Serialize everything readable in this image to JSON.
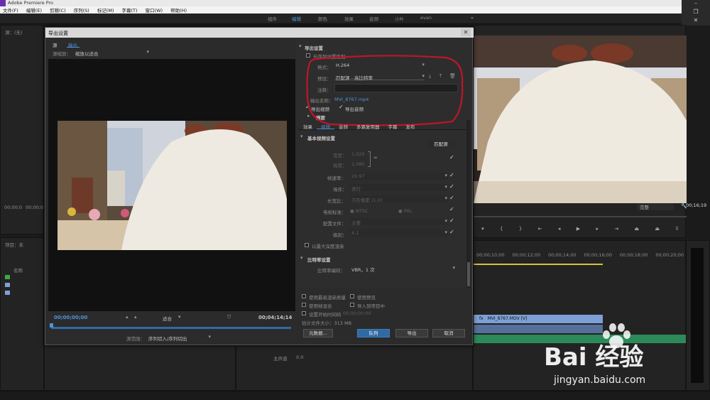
{
  "app": {
    "title": "Adobe Premiere Pro",
    "menu": [
      "文件(F)",
      "编辑(E)",
      "剪辑(C)",
      "序列(S)",
      "标记(M)",
      "字幕(T)",
      "窗口(W)",
      "帮助(H)"
    ],
    "workspaces": [
      "组件",
      "编辑",
      "颜色",
      "效果",
      "音频",
      "小叶",
      "evan"
    ],
    "active_workspace": "编辑"
  },
  "left_panel": {
    "source_label": "源：(无)",
    "timecode_left": "00;00;0",
    "timecode_mid": "00;00;0",
    "project_label": "项目：未",
    "media_label": "名称",
    "media_label2": "序列名"
  },
  "program_monitor": {
    "timecode": "00;16;19",
    "zoom": "完整"
  },
  "timeline": {
    "ruler": [
      "00;00;10;00",
      "00;00;12;00",
      "00;00;14;00",
      "00;00;16;00",
      "00;00;18;00",
      "00;00;20;00"
    ],
    "clip_video": "MVI_8767.MOV [V]",
    "clip_fx": "fx",
    "track_master": "主声道",
    "master_value": "0.0"
  },
  "dialog": {
    "title": "导出设置",
    "tabs": [
      "源",
      "输出"
    ],
    "active_tab": "输出",
    "source_scaling_label": "源缩放：",
    "source_scaling_value": "缩放以适合",
    "timecode_in": "00;00;00;00",
    "timecode_out": "00;04;14;14",
    "fit_label": "适合",
    "source_range_label": "源范围：",
    "source_range_value": "序列切入/序列切出",
    "export_settings": {
      "section": "导出设置",
      "match_sequence": "与序列设置匹配",
      "format_label": "格式：",
      "format_value": "H.264",
      "preset_label": "预设：",
      "preset_value": "匹配源 - 高比特率",
      "comments_label": "注释：",
      "output_name_label": "输出名称：",
      "output_name_value": "MVI_8767.mp4",
      "export_video": "导出视频",
      "export_audio": "导出音频",
      "summary": "摘要"
    },
    "setting_tabs": [
      "效果",
      "视频",
      "音频",
      "多路复用器",
      "字幕",
      "发布"
    ],
    "active_setting_tab": "视频",
    "basic_video": {
      "section": "基本视频设置",
      "match_source": "匹配源",
      "width_label": "宽度：",
      "width_value": "1,920",
      "height_label": "高度：",
      "height_value": "1,080",
      "framerate_label": "帧速率：",
      "framerate_value": "29.97",
      "field_label": "场序：",
      "field_value": "逐行",
      "aspect_label": "长宽比：",
      "aspect_value": "方形像素 (1.0)",
      "tv_label": "电视标准：",
      "tv_ntsc": "NTSC",
      "tv_pal": "PAL",
      "profile_label": "配置文件：",
      "profile_value": "主要",
      "level_label": "级别：",
      "level_value": "4.1",
      "max_depth": "以最大深度渲染"
    },
    "bitrate": {
      "section": "比特率设置",
      "encoding_label": "比特率编码：",
      "encoding_value": "VBR，1 次"
    },
    "options": {
      "max_quality": "使用最高渲染质量",
      "use_preview": "使用预览",
      "use_frame_blend": "使用帧混合",
      "import_project": "导入到项目中",
      "set_start_tc": "设置开始时间码",
      "start_tc_value": "00;00;00;00",
      "file_size": "估计文件大小：313 MB"
    },
    "buttons": {
      "metadata": "元数据...",
      "queue": "队列",
      "export": "导出",
      "cancel": "取消"
    }
  },
  "watermark": {
    "brand": "Bai 经验",
    "url": "jingyan.baidu.com"
  },
  "colors": {
    "accent_blue": "#4f93d6",
    "annotation_red": "#c0152a",
    "clip_video": "#7e9fd6",
    "clip_audio": "#2c8a5a"
  }
}
